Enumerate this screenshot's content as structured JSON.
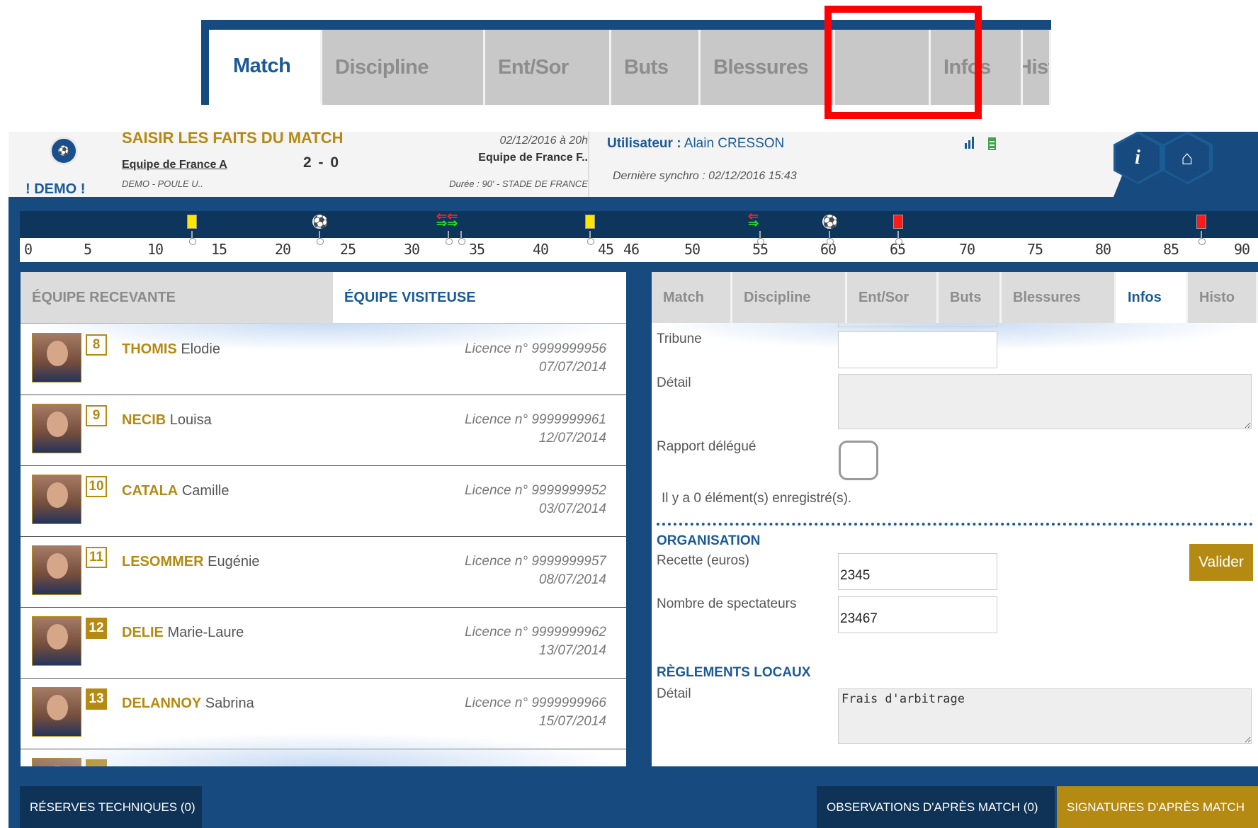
{
  "zoom_tabs": [
    "Match",
    "Discipline",
    "Ent/Sor",
    "Buts",
    "Blessures",
    "",
    "Infos",
    "Histo"
  ],
  "header": {
    "demo": "! DEMO !",
    "title": "SAISIR LES FAITS DU MATCH",
    "team": "Equipe de France A",
    "score": "2 - 0",
    "competition": "DEMO - POULE U..",
    "date": "02/12/2016 à 20h",
    "opponent": "Equipe de France F..",
    "duration": "Durée : 90' - STADE DE FRANCE",
    "user_label": "Utilisateur :",
    "user_name": "Alain CRESSON",
    "sync": "Dernière synchro : 02/12/2016 15:43",
    "info_icon": "i",
    "home_icon": "⌂",
    "signal_icon": "signal-icon",
    "battery_icon": "battery-icon"
  },
  "timeline": {
    "ticks": [
      "0",
      "5",
      "10",
      "15",
      "20",
      "25",
      "30",
      "35",
      "40",
      "45",
      "46",
      "50",
      "55",
      "60",
      "65",
      "70",
      "75",
      "80",
      "85",
      "90"
    ],
    "events": [
      {
        "minute": 13,
        "type": "yellow-card"
      },
      {
        "minute": 23,
        "type": "goal"
      },
      {
        "minute": 33,
        "type": "substitution"
      },
      {
        "minute": 44,
        "type": "yellow-card"
      },
      {
        "minute": 55,
        "type": "substitution"
      },
      {
        "minute": 60,
        "type": "goal"
      },
      {
        "minute": 65,
        "type": "red-card"
      },
      {
        "minute": 88,
        "type": "red-card"
      }
    ]
  },
  "left": {
    "tab_home": "ÉQUIPE RECEVANTE",
    "tab_away": "ÉQUIPE VISITEUSE",
    "players": [
      {
        "num": "8",
        "last": "THOMIS",
        "first": "Elodie",
        "licence": "Licence n° 9999999956",
        "date": "07/07/2014"
      },
      {
        "num": "9",
        "last": "NECIB",
        "first": "Louisa",
        "licence": "Licence n° 9999999961",
        "date": "12/07/2014"
      },
      {
        "num": "10",
        "last": "CATALA",
        "first": "Camille",
        "licence": "Licence n° 9999999952",
        "date": "03/07/2014"
      },
      {
        "num": "11",
        "last": "LESOMMER",
        "first": "Eugénie",
        "licence": "Licence n° 9999999957",
        "date": "08/07/2014"
      },
      {
        "num": "12",
        "last": "DELIE",
        "first": "Marie-Laure",
        "licence": "Licence n° 9999999962",
        "date": "13/07/2014"
      },
      {
        "num": "13",
        "last": "DELANNOY",
        "first": "Sabrina",
        "licence": "Licence n° 9999999966",
        "date": "15/07/2014"
      }
    ]
  },
  "right": {
    "tabs": [
      "Match",
      "Discipline",
      "Ent/Sor",
      "Buts",
      "Blessures",
      "Infos",
      "Histo"
    ],
    "tribune_label": "Tribune",
    "detail_label": "Détail",
    "rapport_label": "Rapport délégué",
    "count_text": "Il y a 0 élément(s) enregistré(s).",
    "org_title": "ORGANISATION",
    "valider": "Valider",
    "recette_label": "Recette (euros)",
    "recette_value": "2345",
    "spectateurs_label": "Nombre de spectateurs",
    "spectateurs_value": "23467",
    "regl_title": "RÈGLEMENTS LOCAUX",
    "regl_detail_label": "Détail",
    "regl_detail_value": "Frais d'arbitrage"
  },
  "footer": {
    "reserves": "RÉSERVES TECHNIQUES (0)",
    "observations": "OBSERVATIONS D'APRÈS MATCH (0)",
    "signatures": "SIGNATURES D'APRÈS MATCH"
  },
  "colors": {
    "brand_blue": "#174a7e",
    "gold": "#b48a12",
    "highlight": "#ff0000"
  }
}
